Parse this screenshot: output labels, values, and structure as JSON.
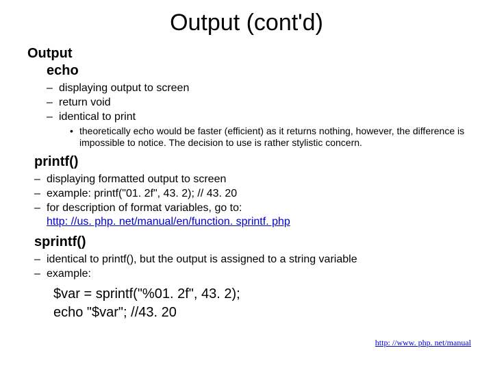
{
  "title": "Output (cont'd)",
  "section_output": "Output",
  "section_echo": "echo",
  "echo_points": [
    "displaying output to screen",
    "return void",
    "identical to print"
  ],
  "echo_sub": "theoretically echo would be faster (efficient) as it returns nothing, however, the difference is impossible to notice. The decision to use is rather stylistic concern.",
  "section_printf": "printf()",
  "printf_points": {
    "p1": "displaying formatted output to screen",
    "p2": "example: printf(\"01. 2f\", 43. 2); // 43. 20",
    "p3_prefix": "for description of format variables, go to: ",
    "p3_link": "http: //us. php. net/manual/en/function. sprintf. php"
  },
  "section_sprintf": "sprintf()",
  "sprintf_points": [
    "identical to printf(), but the output is assigned to a string variable",
    "example:"
  ],
  "code": {
    "line1": "$var = sprintf(\"%01. 2f\", 43. 2);",
    "line2": "echo \"$var\"; //43. 20"
  },
  "footer_link": "http: //www. php. net/manual"
}
